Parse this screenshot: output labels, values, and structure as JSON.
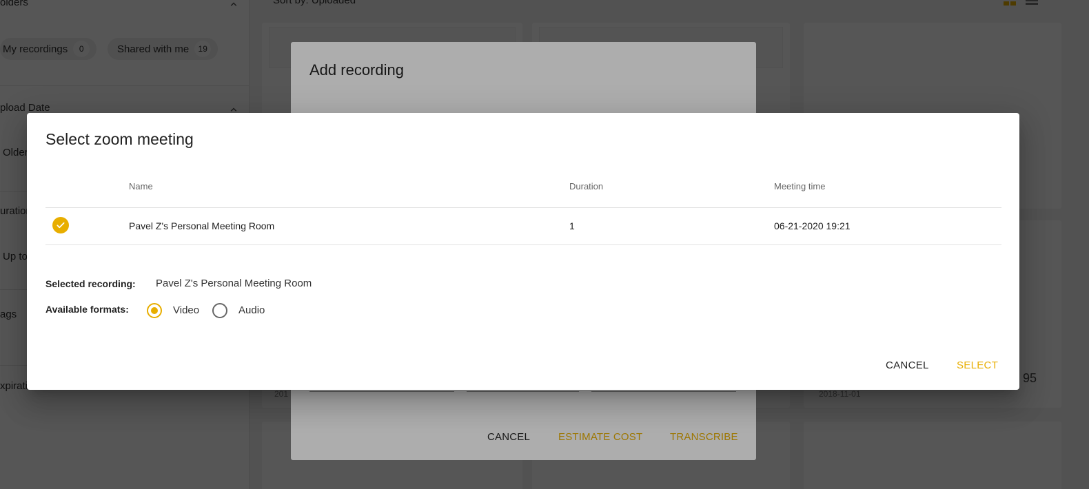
{
  "colors": {
    "accent": "#e8ae00",
    "text": "#222222",
    "muted": "#666666",
    "scrim": "rgba(0,0,0,0.5)"
  },
  "background": {
    "sidebar": {
      "folders_title": "olders",
      "chips": [
        {
          "label": "My recordings",
          "count": "0"
        },
        {
          "label": "Shared with me",
          "count": "19"
        }
      ],
      "upload_date_title": "pload Date",
      "older_label": "Older",
      "duration_title": "uration",
      "up_to_label": "Up to",
      "tags_title": "ags",
      "expiration_title": "xpiration Date"
    },
    "header": {
      "title": "Sort by: Uploaded"
    },
    "cards": {
      "date_left": "201",
      "date_right": "2018-11-01",
      "number_right": "95"
    }
  },
  "add_recording_dialog": {
    "title": "Add recording",
    "buttons": {
      "cancel": "CANCEL",
      "estimate": "ESTIMATE COST",
      "transcribe": "TRANSCRIBE"
    }
  },
  "zoom_dialog": {
    "title": "Select zoom meeting",
    "columns": {
      "name": "Name",
      "duration": "Duration",
      "meeting_time": "Meeting time"
    },
    "rows": [
      {
        "name": "Pavel Z's Personal Meeting Room",
        "duration": "1",
        "meeting_time": "06-21-2020 19:21",
        "selected_icon": "check-circle-icon"
      }
    ],
    "selected_recording_label": "Selected recording:",
    "selected_recording_value": "Pavel Z's Personal Meeting Room",
    "available_formats_label": "Available formats:",
    "formats": [
      {
        "label": "Video",
        "checked": true
      },
      {
        "label": "Audio",
        "checked": false
      }
    ],
    "buttons": {
      "cancel": "CANCEL",
      "select": "SELECT"
    }
  }
}
